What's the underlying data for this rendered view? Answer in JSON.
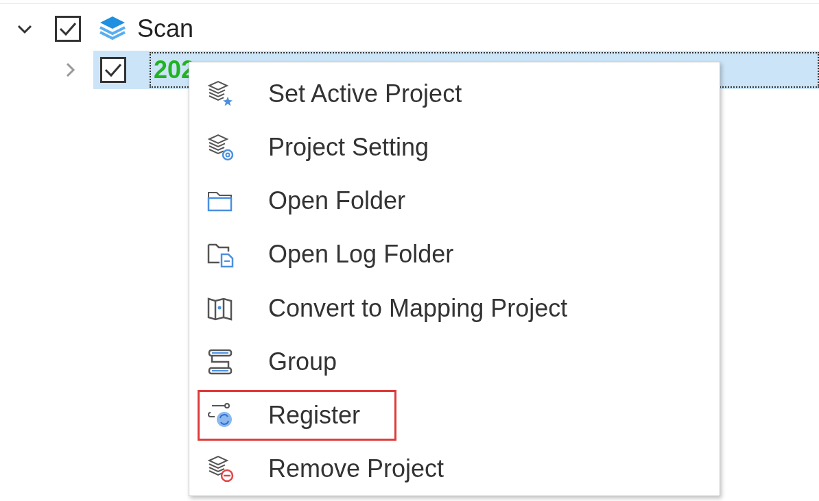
{
  "tree": [
    {
      "label": "Scan",
      "expanded": true,
      "checked": true,
      "selected": false,
      "children": [
        {
          "label": "202",
          "expanded": false,
          "checked": true,
          "selected": true
        }
      ]
    }
  ],
  "context_menu": {
    "items": [
      {
        "label": "Set Active Project",
        "highlighted": false
      },
      {
        "label": "Project Setting",
        "highlighted": false
      },
      {
        "label": "Open Folder",
        "highlighted": false
      },
      {
        "label": "Open Log Folder",
        "highlighted": false
      },
      {
        "label": "Convert to Mapping Project",
        "highlighted": false
      },
      {
        "label": "Group",
        "highlighted": false
      },
      {
        "label": "Register",
        "highlighted": true
      },
      {
        "label": "Remove Project",
        "highlighted": false
      }
    ]
  }
}
